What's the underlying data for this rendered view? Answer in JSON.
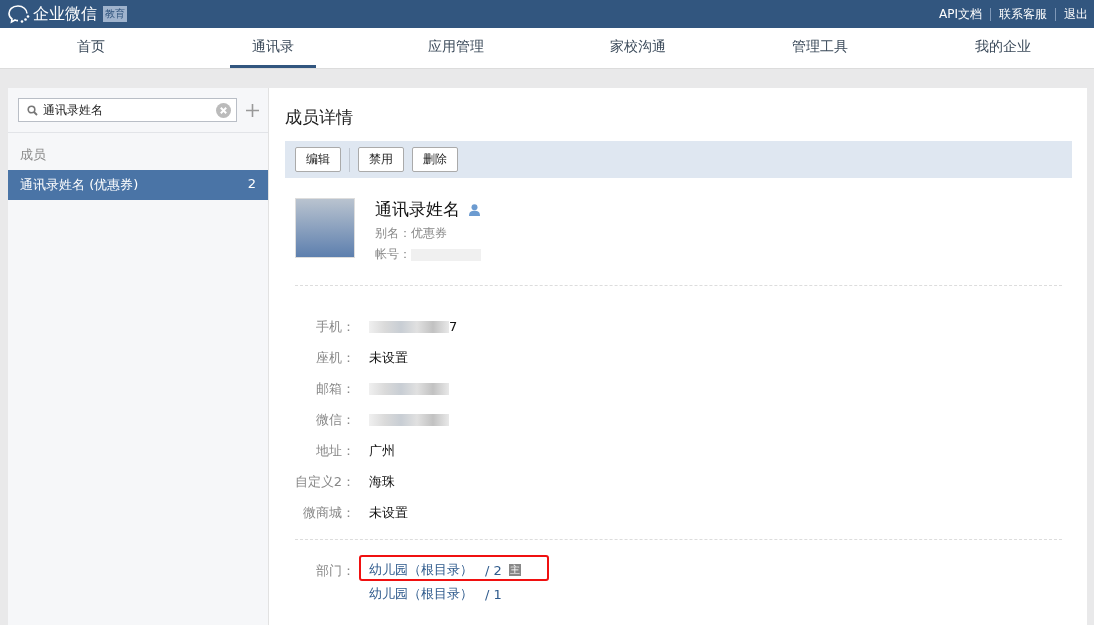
{
  "header": {
    "logo": "企业微信",
    "badge": "教育",
    "links": [
      "API文档",
      "联系客服",
      "退出"
    ]
  },
  "nav": [
    {
      "label": "首页",
      "selected": false
    },
    {
      "label": "通讯录",
      "selected": true
    },
    {
      "label": "应用管理",
      "selected": false
    },
    {
      "label": "家校沟通",
      "selected": false
    },
    {
      "label": "管理工具",
      "selected": false
    },
    {
      "label": "我的企业",
      "selected": false
    }
  ],
  "sidebar": {
    "search": {
      "value": "通讯录姓名"
    },
    "section": "成员",
    "items": [
      {
        "name": "通讯录姓名 (优惠券)",
        "count": "2",
        "selected": true
      }
    ]
  },
  "detail": {
    "title": "成员详情",
    "buttons": [
      "编辑",
      "禁用",
      "删除"
    ],
    "name": "通讯录姓名",
    "alias_label": "别名：",
    "alias": "优惠券",
    "account_label": "帐号：",
    "fields": [
      {
        "label": "手机：",
        "value": "7",
        "redacted": true
      },
      {
        "label": "座机：",
        "value": "未设置",
        "redacted": false
      },
      {
        "label": "邮箱：",
        "redacted": true
      },
      {
        "label": "微信：",
        "redacted": true
      },
      {
        "label": "地址：",
        "value": "广州",
        "redacted": false
      },
      {
        "label": "自定义2：",
        "value": "海珠",
        "redacted": false
      },
      {
        "label": "微商城：",
        "value": "未设置",
        "redacted": false
      }
    ],
    "department_label": "部门：",
    "departments": [
      {
        "name": "幼儿园（根目录）",
        "sep": "/",
        "count": "2",
        "primary_badge": "主",
        "highlighted": true
      },
      {
        "name": "幼儿园（根目录）",
        "sep": "/",
        "count": "1",
        "highlighted": false
      }
    ]
  }
}
